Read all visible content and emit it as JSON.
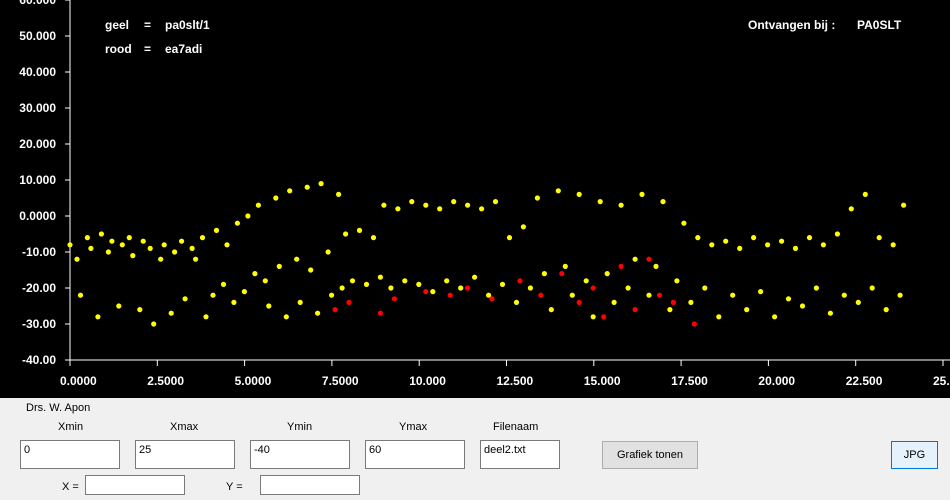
{
  "chart_data": {
    "type": "scatter",
    "xlim": [
      0,
      25
    ],
    "ylim": [
      -40,
      60
    ],
    "x_ticks": [
      "0.0000",
      "2.5000",
      "5.0000",
      "7.5000",
      "10.000",
      "12.500",
      "15.000",
      "17.500",
      "20.000",
      "22.500",
      "25."
    ],
    "y_ticks": [
      "60.000",
      "50.000",
      "40.000",
      "30.000",
      "20.000",
      "10.000",
      "0.0000",
      "-10.00",
      "-20.00",
      "-30.00",
      "-40.00"
    ],
    "grid": false,
    "legend": [
      {
        "color_name": "geel",
        "eq": "=",
        "station": "pa0slt/1",
        "color": "#ffff00"
      },
      {
        "color_name": "rood",
        "eq": "=",
        "station": "ea7adi",
        "color": "#ff0000"
      }
    ],
    "received_label": "Ontvangen bij :",
    "received_station": "PA0SLT",
    "series": [
      {
        "name": "pa0slt/1",
        "color": "#ffff00",
        "points": [
          [
            0.0,
            -8
          ],
          [
            0.2,
            -12
          ],
          [
            0.3,
            -22
          ],
          [
            0.5,
            -6
          ],
          [
            0.6,
            -9
          ],
          [
            0.8,
            -28
          ],
          [
            0.9,
            -5
          ],
          [
            1.1,
            -10
          ],
          [
            1.2,
            -7
          ],
          [
            1.4,
            -25
          ],
          [
            1.5,
            -8
          ],
          [
            1.7,
            -6
          ],
          [
            1.8,
            -11
          ],
          [
            2.0,
            -26
          ],
          [
            2.1,
            -7
          ],
          [
            2.3,
            -9
          ],
          [
            2.4,
            -30
          ],
          [
            2.6,
            -12
          ],
          [
            2.7,
            -8
          ],
          [
            2.9,
            -27
          ],
          [
            3.0,
            -10
          ],
          [
            3.2,
            -7
          ],
          [
            3.3,
            -23
          ],
          [
            3.5,
            -9
          ],
          [
            3.6,
            -12
          ],
          [
            3.8,
            -6
          ],
          [
            3.9,
            -28
          ],
          [
            4.1,
            -22
          ],
          [
            4.2,
            -4
          ],
          [
            4.4,
            -19
          ],
          [
            4.5,
            -8
          ],
          [
            4.7,
            -24
          ],
          [
            4.8,
            -2
          ],
          [
            5.0,
            -21
          ],
          [
            5.1,
            0
          ],
          [
            5.3,
            -16
          ],
          [
            5.4,
            3
          ],
          [
            5.6,
            -18
          ],
          [
            5.7,
            -25
          ],
          [
            5.9,
            5
          ],
          [
            6.0,
            -14
          ],
          [
            6.2,
            -28
          ],
          [
            6.3,
            7
          ],
          [
            6.5,
            -12
          ],
          [
            6.6,
            -24
          ],
          [
            6.8,
            8
          ],
          [
            6.9,
            -15
          ],
          [
            7.1,
            -27
          ],
          [
            7.2,
            9
          ],
          [
            7.4,
            -10
          ],
          [
            7.5,
            -22
          ],
          [
            7.7,
            6
          ],
          [
            7.8,
            -20
          ],
          [
            7.9,
            -5
          ],
          [
            8.1,
            -18
          ],
          [
            8.3,
            -4
          ],
          [
            8.5,
            -19
          ],
          [
            8.7,
            -6
          ],
          [
            8.9,
            -17
          ],
          [
            9.0,
            3
          ],
          [
            9.2,
            -20
          ],
          [
            9.4,
            2
          ],
          [
            9.6,
            -18
          ],
          [
            9.8,
            4
          ],
          [
            10.0,
            -19
          ],
          [
            10.2,
            3
          ],
          [
            10.4,
            -21
          ],
          [
            10.6,
            2
          ],
          [
            10.8,
            -18
          ],
          [
            11.0,
            4
          ],
          [
            11.2,
            -20
          ],
          [
            11.4,
            3
          ],
          [
            11.6,
            -17
          ],
          [
            11.8,
            2
          ],
          [
            12.0,
            -22
          ],
          [
            12.2,
            4
          ],
          [
            12.4,
            -19
          ],
          [
            12.6,
            -6
          ],
          [
            12.8,
            -24
          ],
          [
            13.0,
            -3
          ],
          [
            13.2,
            -20
          ],
          [
            13.4,
            5
          ],
          [
            13.6,
            -16
          ],
          [
            13.8,
            -26
          ],
          [
            14.0,
            7
          ],
          [
            14.2,
            -14
          ],
          [
            14.4,
            -22
          ],
          [
            14.6,
            6
          ],
          [
            14.8,
            -18
          ],
          [
            15.0,
            -28
          ],
          [
            15.2,
            4
          ],
          [
            15.4,
            -16
          ],
          [
            15.6,
            -24
          ],
          [
            15.8,
            3
          ],
          [
            16.0,
            -20
          ],
          [
            16.2,
            -12
          ],
          [
            16.4,
            6
          ],
          [
            16.6,
            -22
          ],
          [
            16.8,
            -14
          ],
          [
            17.0,
            4
          ],
          [
            17.2,
            -26
          ],
          [
            17.4,
            -18
          ],
          [
            17.6,
            -2
          ],
          [
            17.8,
            -24
          ],
          [
            18.0,
            -6
          ],
          [
            18.2,
            -20
          ],
          [
            18.4,
            -8
          ],
          [
            18.6,
            -28
          ],
          [
            18.8,
            -7
          ],
          [
            19.0,
            -22
          ],
          [
            19.2,
            -9
          ],
          [
            19.4,
            -26
          ],
          [
            19.6,
            -6
          ],
          [
            19.8,
            -21
          ],
          [
            20.0,
            -8
          ],
          [
            20.2,
            -28
          ],
          [
            20.4,
            -7
          ],
          [
            20.6,
            -23
          ],
          [
            20.8,
            -9
          ],
          [
            21.0,
            -25
          ],
          [
            21.2,
            -6
          ],
          [
            21.4,
            -20
          ],
          [
            21.6,
            -8
          ],
          [
            21.8,
            -27
          ],
          [
            22.0,
            -5
          ],
          [
            22.2,
            -22
          ],
          [
            22.4,
            2
          ],
          [
            22.6,
            -24
          ],
          [
            22.8,
            6
          ],
          [
            23.0,
            -20
          ],
          [
            23.2,
            -6
          ],
          [
            23.4,
            -26
          ],
          [
            23.6,
            -8
          ],
          [
            23.8,
            -22
          ],
          [
            23.9,
            3
          ]
        ]
      },
      {
        "name": "ea7adi",
        "color": "#ff0000",
        "points": [
          [
            7.6,
            -26
          ],
          [
            8.0,
            -24
          ],
          [
            8.9,
            -27
          ],
          [
            9.3,
            -23
          ],
          [
            10.2,
            -21
          ],
          [
            10.9,
            -22
          ],
          [
            11.4,
            -20
          ],
          [
            12.1,
            -23
          ],
          [
            12.9,
            -18
          ],
          [
            13.5,
            -22
          ],
          [
            14.1,
            -16
          ],
          [
            14.6,
            -24
          ],
          [
            15.0,
            -20
          ],
          [
            15.3,
            -28
          ],
          [
            15.8,
            -14
          ],
          [
            16.2,
            -26
          ],
          [
            16.6,
            -12
          ],
          [
            16.9,
            -22
          ],
          [
            17.3,
            -24
          ],
          [
            17.9,
            -30
          ]
        ]
      }
    ]
  },
  "controls": {
    "author": "Drs. W. Apon",
    "xmin_label": "Xmin",
    "xmax_label": "Xmax",
    "ymin_label": "Ymin",
    "ymax_label": "Ymax",
    "filename_label": "Filenaam",
    "xmin_value": "0",
    "xmax_value": "25",
    "ymin_value": "-40",
    "ymax_value": "60",
    "filename_value": "deel2.txt",
    "show_button": "Grafiek tonen",
    "jpg_button": "JPG",
    "x_label": "X =",
    "y_label": "Y =",
    "x_value": "",
    "y_value": ""
  }
}
